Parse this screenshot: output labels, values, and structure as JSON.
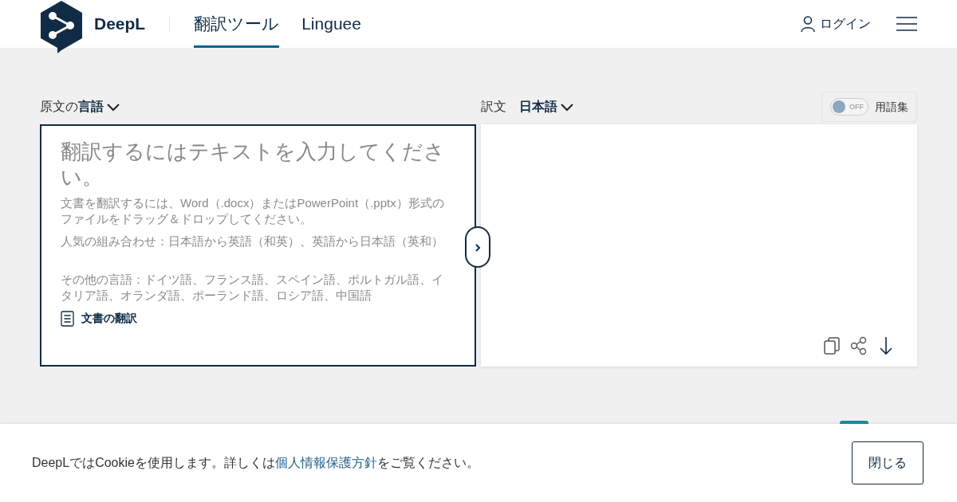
{
  "header": {
    "logo_text": "DeepL",
    "tabs": [
      {
        "label": "翻訳ツール",
        "selected": true
      },
      {
        "label": "Linguee",
        "selected": false
      }
    ],
    "login": "ログイン"
  },
  "source_language": {
    "label": "原文の**言語**"
  },
  "target_language": {
    "label": "訳文",
    "value": "日本語"
  },
  "glossary": {
    "toggle_text": "OFF",
    "on": false,
    "label": "用語集"
  },
  "source": {
    "placeholder": "翻訳するにはテキストを入力してください。",
    "hints": [
      "文書を翻訳するには、Word（.docx）またはPowerPoint（.pptx）形式のファイルをドラッグ＆ドロップしてください。",
      "人気の組み合わせ：日本語から英語（和英）、英語から日本語（英和）",
      "その他の言語：ドイツ語、フランス語、スペイン語、ポルトガル語、イタリア語、オランダ語、ポーランド語、ロシア語、中国語"
    ],
    "document_link": "文書の翻訳"
  },
  "cookie_bar": {
    "text_before": "DeepLではCookieを使用します。詳しくは",
    "link": "個人情報保護方針",
    "text_after": "をご覧ください。",
    "close_button": "閉じる"
  }
}
